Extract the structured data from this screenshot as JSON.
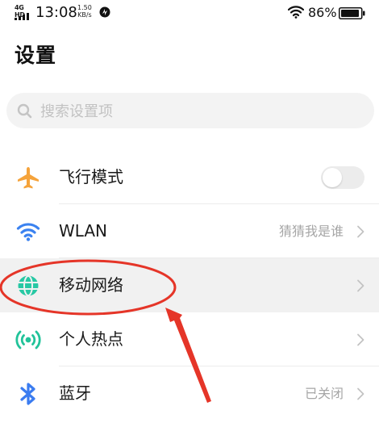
{
  "status_bar": {
    "network": "4G HD",
    "time": "13:08",
    "speed_value": "1.50",
    "speed_unit": "KB/s",
    "battery": "86%"
  },
  "header": {
    "title": "设置"
  },
  "search": {
    "placeholder": "搜索设置项",
    "value": ""
  },
  "settings": [
    {
      "id": "airplane",
      "label": "飞行模式",
      "icon": "airplane-icon",
      "control": "toggle",
      "enabled": false,
      "value": ""
    },
    {
      "id": "wlan",
      "label": "WLAN",
      "icon": "wifi-icon",
      "control": "chevron",
      "value": "猜猜我是谁"
    },
    {
      "id": "mobile-network",
      "label": "移动网络",
      "icon": "globe-icon",
      "control": "chevron",
      "value": "",
      "highlighted": true
    },
    {
      "id": "hotspot",
      "label": "个人热点",
      "icon": "hotspot-icon",
      "control": "chevron",
      "value": ""
    },
    {
      "id": "bluetooth",
      "label": "蓝牙",
      "icon": "bluetooth-icon",
      "control": "chevron",
      "value": "已关闭"
    }
  ],
  "colors": {
    "airplane": "#f5a33b",
    "wifi": "#3b82f0",
    "mobile_network": "#27c8a4",
    "hotspot": "#22c39a",
    "bluetooth": "#3b7cf0",
    "annotation": "#e53528"
  }
}
